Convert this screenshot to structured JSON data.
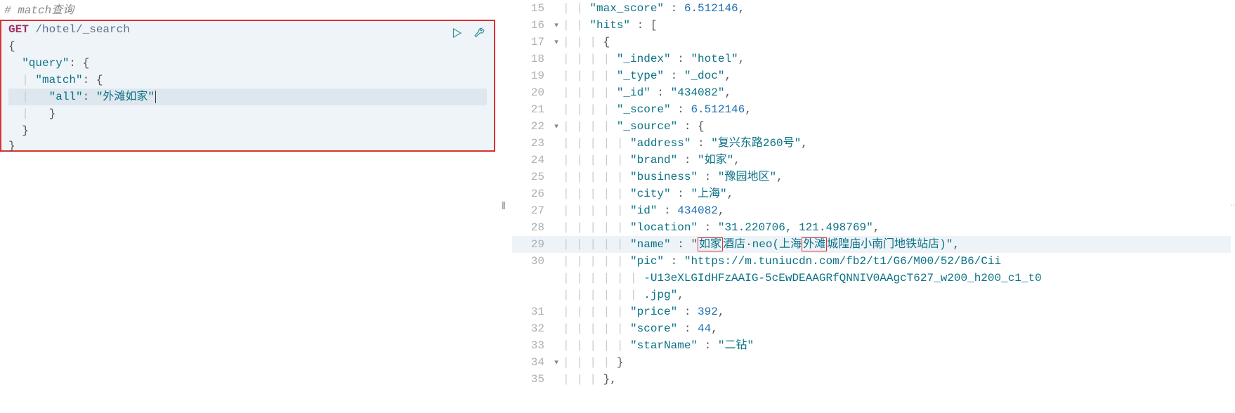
{
  "left": {
    "comment": "# match查询",
    "method": "GET",
    "path": " /hotel/_search",
    "lines": {
      "l1": "{",
      "l2_key": "\"query\"",
      "l3_key": "\"match\"",
      "l4_key": "\"all\"",
      "l4_val": "\"外滩如家\"",
      "l5": "}",
      "l6": "}",
      "l7": "}"
    }
  },
  "right": {
    "rows": [
      {
        "n": 15,
        "f": "",
        "pre": "    ",
        "html": [
          [
            "k",
            "\"max_score\""
          ],
          [
            "p",
            " : "
          ],
          [
            "num",
            "6.512146"
          ],
          [
            "p",
            ","
          ]
        ]
      },
      {
        "n": 16,
        "f": "▾",
        "pre": "    ",
        "html": [
          [
            "k",
            "\"hits\""
          ],
          [
            "p",
            " : ["
          ]
        ]
      },
      {
        "n": 17,
        "f": "▾",
        "pre": "      ",
        "html": [
          [
            "p",
            "{"
          ]
        ]
      },
      {
        "n": 18,
        "f": "",
        "pre": "        ",
        "html": [
          [
            "k",
            "\"_index\""
          ],
          [
            "p",
            " : "
          ],
          [
            "s",
            "\"hotel\""
          ],
          [
            "p",
            ","
          ]
        ]
      },
      {
        "n": 19,
        "f": "",
        "pre": "        ",
        "html": [
          [
            "k",
            "\"_type\""
          ],
          [
            "p",
            " : "
          ],
          [
            "s",
            "\"_doc\""
          ],
          [
            "p",
            ","
          ]
        ]
      },
      {
        "n": 20,
        "f": "",
        "pre": "        ",
        "html": [
          [
            "k",
            "\"_id\""
          ],
          [
            "p",
            " : "
          ],
          [
            "s",
            "\"434082\""
          ],
          [
            "p",
            ","
          ]
        ]
      },
      {
        "n": 21,
        "f": "",
        "pre": "        ",
        "html": [
          [
            "k",
            "\"_score\""
          ],
          [
            "p",
            " : "
          ],
          [
            "num",
            "6.512146"
          ],
          [
            "p",
            ","
          ]
        ]
      },
      {
        "n": 22,
        "f": "▾",
        "pre": "        ",
        "html": [
          [
            "k",
            "\"_source\""
          ],
          [
            "p",
            " : {"
          ]
        ]
      },
      {
        "n": 23,
        "f": "",
        "pre": "          ",
        "html": [
          [
            "k",
            "\"address\""
          ],
          [
            "p",
            " : "
          ],
          [
            "s",
            "\"复兴东路260号\""
          ],
          [
            "p",
            ","
          ]
        ]
      },
      {
        "n": 24,
        "f": "",
        "pre": "          ",
        "html": [
          [
            "k",
            "\"brand\""
          ],
          [
            "p",
            " : "
          ],
          [
            "s",
            "\"如家\""
          ],
          [
            "p",
            ","
          ]
        ]
      },
      {
        "n": 25,
        "f": "",
        "pre": "          ",
        "html": [
          [
            "k",
            "\"business\""
          ],
          [
            "p",
            " : "
          ],
          [
            "s",
            "\"豫园地区\""
          ],
          [
            "p",
            ","
          ]
        ]
      },
      {
        "n": 26,
        "f": "",
        "pre": "          ",
        "html": [
          [
            "k",
            "\"city\""
          ],
          [
            "p",
            " : "
          ],
          [
            "s",
            "\"上海\""
          ],
          [
            "p",
            ","
          ]
        ]
      },
      {
        "n": 27,
        "f": "",
        "pre": "          ",
        "html": [
          [
            "k",
            "\"id\""
          ],
          [
            "p",
            " : "
          ],
          [
            "num",
            "434082"
          ],
          [
            "p",
            ","
          ]
        ]
      },
      {
        "n": 28,
        "f": "",
        "pre": "          ",
        "html": [
          [
            "k",
            "\"location\""
          ],
          [
            "p",
            " : "
          ],
          [
            "s",
            "\"31.220706, 121.498769\""
          ],
          [
            "p",
            ","
          ]
        ]
      },
      {
        "n": 29,
        "f": "",
        "hl": true,
        "pre": "          ",
        "html": [
          [
            "k",
            "\"name\""
          ],
          [
            "p",
            " : "
          ],
          [
            "p",
            "\""
          ],
          [
            "hl",
            "如家"
          ],
          [
            "s",
            "酒店·neo(上海"
          ],
          [
            "hl",
            "外滩"
          ],
          [
            "s",
            "城隍庙小南门地铁站店)\""
          ],
          [
            "p",
            ","
          ]
        ]
      },
      {
        "n": 30,
        "f": "",
        "pre": "          ",
        "html": [
          [
            "k",
            "\"pic\""
          ],
          [
            "p",
            " : "
          ],
          [
            "s",
            "\"https://m.tuniucdn.com/fb2/t1/G6/M00/52/B6/Cii"
          ]
        ]
      },
      {
        "n": "",
        "f": "",
        "pre": "            ",
        "html": [
          [
            "s",
            "-U13eXLGIdHFzAAIG-5cEwDEAAGRfQNNIV0AAgcT627_w200_h200_c1_t0"
          ]
        ]
      },
      {
        "n": "",
        "f": "",
        "pre": "            ",
        "html": [
          [
            "s",
            ".jpg\""
          ],
          [
            "p",
            ","
          ]
        ]
      },
      {
        "n": 31,
        "f": "",
        "pre": "          ",
        "html": [
          [
            "k",
            "\"price\""
          ],
          [
            "p",
            " : "
          ],
          [
            "num",
            "392"
          ],
          [
            "p",
            ","
          ]
        ]
      },
      {
        "n": 32,
        "f": "",
        "pre": "          ",
        "html": [
          [
            "k",
            "\"score\""
          ],
          [
            "p",
            " : "
          ],
          [
            "num",
            "44"
          ],
          [
            "p",
            ","
          ]
        ]
      },
      {
        "n": 33,
        "f": "",
        "pre": "          ",
        "html": [
          [
            "k",
            "\"starName\""
          ],
          [
            "p",
            " : "
          ],
          [
            "s",
            "\"二钻\""
          ]
        ]
      },
      {
        "n": 34,
        "f": "▾",
        "pre": "        ",
        "html": [
          [
            "p",
            "}"
          ]
        ]
      },
      {
        "n": 35,
        "f": "",
        "pre": "      ",
        "html": [
          [
            "p",
            "},"
          ]
        ]
      }
    ]
  }
}
